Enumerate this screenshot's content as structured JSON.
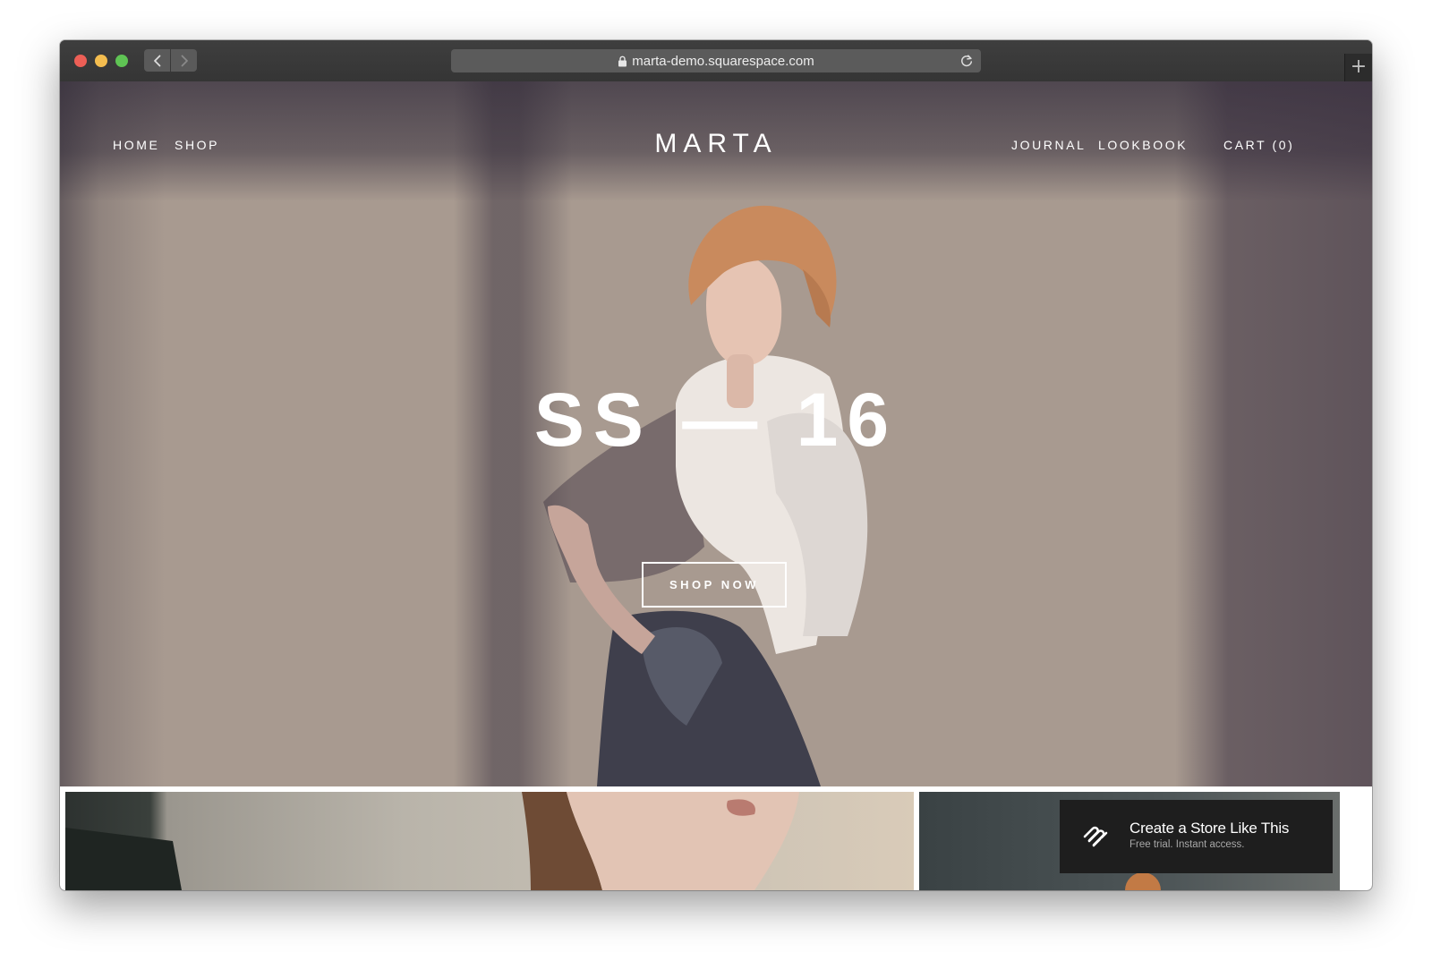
{
  "browser": {
    "url": "marta-demo.squarespace.com",
    "new_tab_label": "+"
  },
  "site": {
    "brand": "MARTA",
    "nav_left": [
      "HOME",
      "SHOP"
    ],
    "nav_right": [
      "JOURNAL",
      "LOOKBOOK"
    ],
    "cart_label": "CART (0)"
  },
  "hero": {
    "headline": "SS — 16",
    "cta_label": "SHOP NOW"
  },
  "promo": {
    "title": "Create a Store Like This",
    "subtitle": "Free trial. Instant access."
  },
  "colors": {
    "wall": "#a89a90",
    "shadow": "#3a3240",
    "badge": "#1e1e1e",
    "text_on_image": "#ffffff"
  },
  "icons": {
    "lock": "lock-icon",
    "reload": "reload-icon",
    "back": "chevron-left-icon",
    "forward": "chevron-right-icon",
    "squarespace": "squarespace-logo-icon"
  }
}
